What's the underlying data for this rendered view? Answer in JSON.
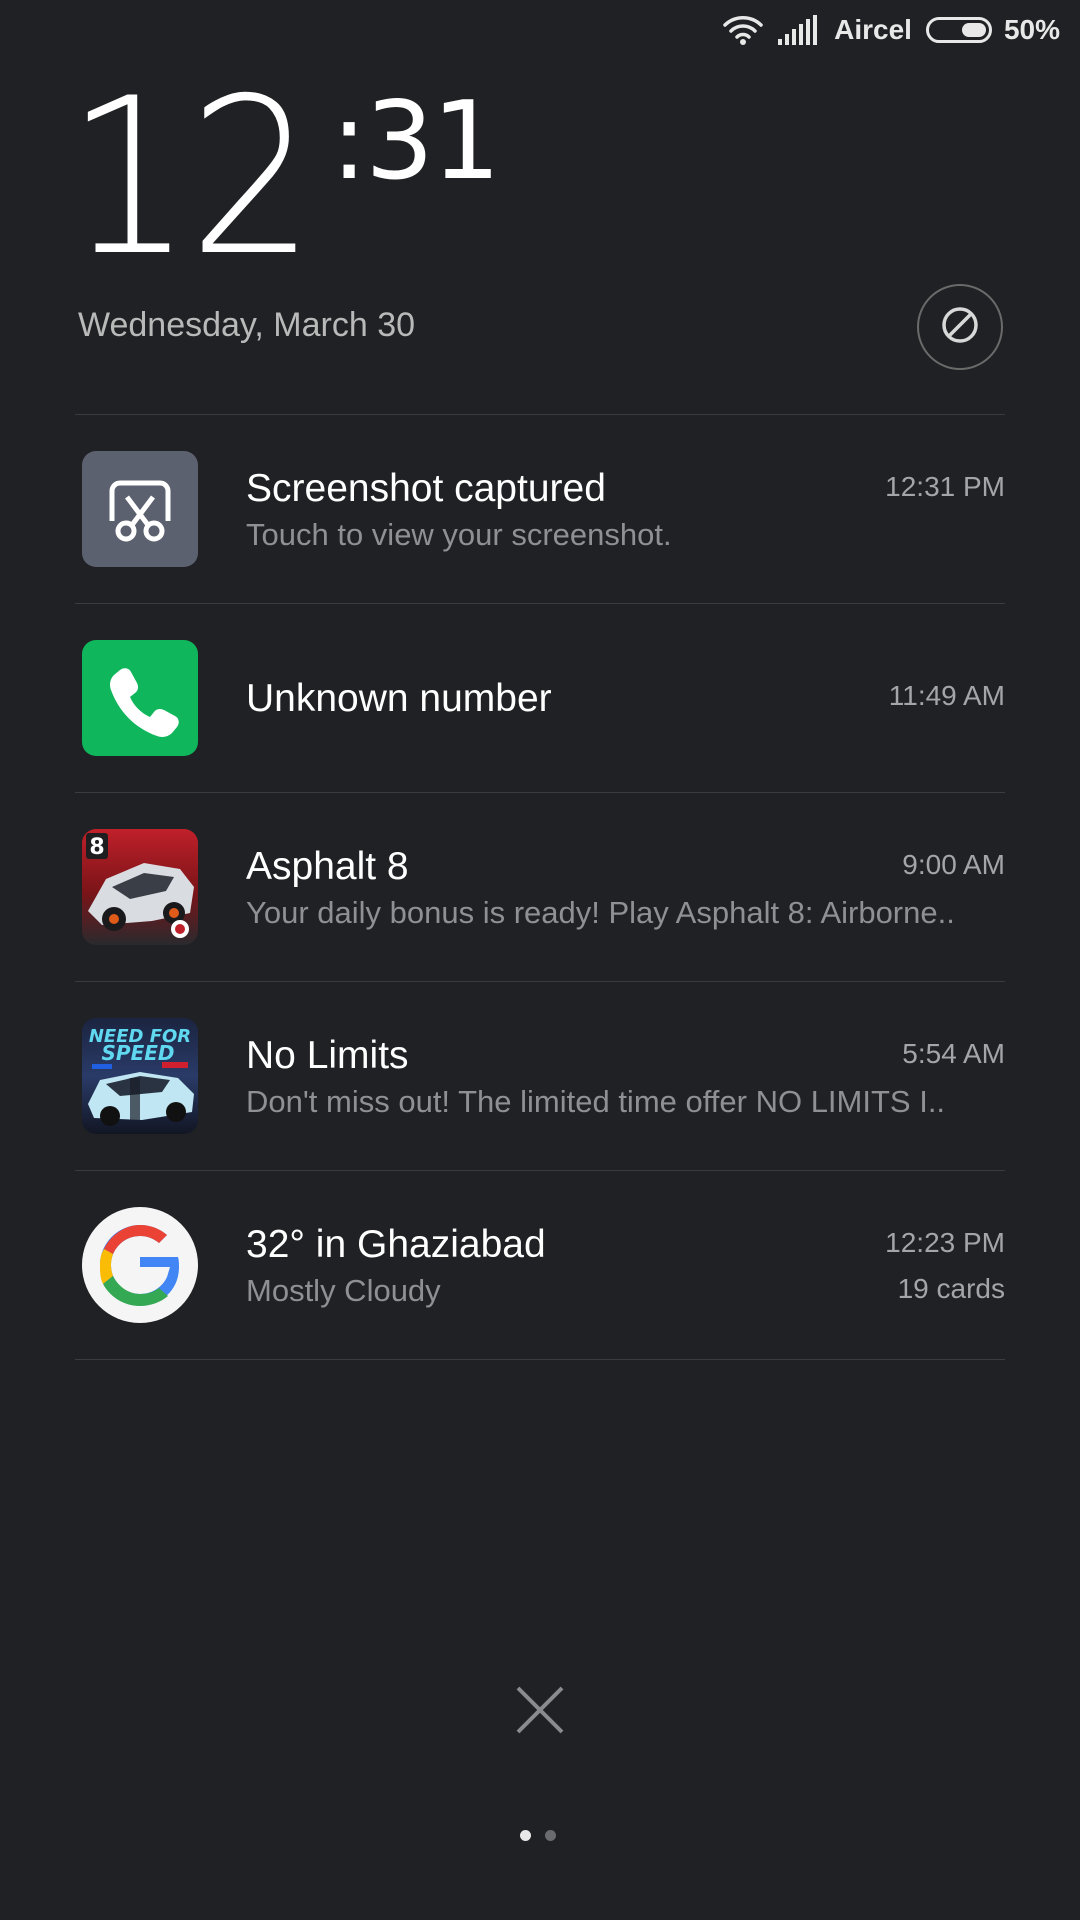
{
  "status_bar": {
    "carrier": "Aircel",
    "battery_level": 50,
    "battery_text": "50%",
    "icons": [
      "wifi-icon",
      "signal-icon",
      "battery-icon"
    ]
  },
  "lockscreen": {
    "time_hours": "12",
    "time_minutes": ":31",
    "date": "Wednesday, March 30"
  },
  "notifications": [
    {
      "app_icon": "screenshot-icon",
      "title": "Screenshot captured",
      "subtitle": "Touch to view your screenshot.",
      "time": "12:31 PM"
    },
    {
      "app_icon": "phone-icon",
      "title": "Unknown number",
      "time": "11:49 AM"
    },
    {
      "app_icon": "asphalt8-icon",
      "title": "Asphalt 8",
      "subtitle": "Your daily bonus is ready! Play Asphalt 8: Airborne..",
      "time": "9:00 AM"
    },
    {
      "app_icon": "need-for-speed-icon",
      "title": "No Limits",
      "subtitle": "Don't miss out! The limited time offer NO LIMITS I..",
      "time": "5:54 AM"
    },
    {
      "app_icon": "google-icon",
      "title": "32° in Ghaziabad",
      "subtitle": "Mostly Cloudy",
      "time": "12:23 PM",
      "extra": "19 cards"
    }
  ],
  "pager": {
    "pages": 2,
    "active": 1
  },
  "colors": {
    "background": "#202124",
    "phone_green": "#0fb65c",
    "screenshot_tile": "#5c6170"
  }
}
